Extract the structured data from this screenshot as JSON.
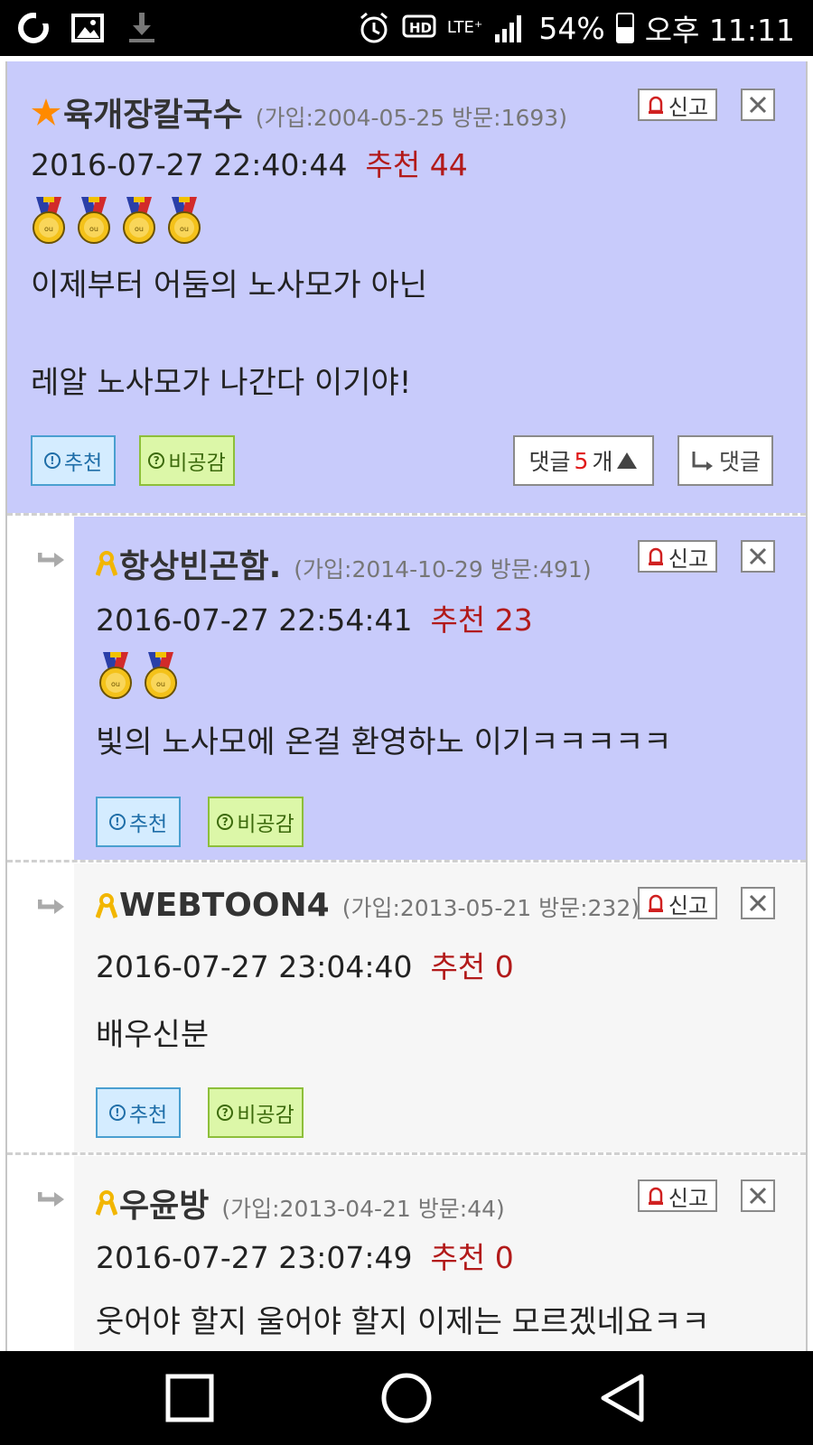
{
  "status_bar": {
    "battery": "54%",
    "time": "오후 11:11",
    "network": "LTE⁺",
    "battery_level": 0.54
  },
  "comments": [
    {
      "nickname": "육개장칼국수",
      "meta": "(가입:2004-05-25 방문:1693)",
      "datetime": "2016-07-27 22:40:44",
      "recommend": "추천 44",
      "medal_count": 4,
      "text_line1": "이제부터 어둠의 노사모가 아닌",
      "text_line2": "레알 노사모가 나간다 이기야!",
      "report_label": "신고",
      "recommend_btn": "추천",
      "disagree_btn": "비공감",
      "reply_count_prefix": "댓글 ",
      "reply_count_num": "5",
      "reply_count_suffix": "개",
      "reply_btn": "댓글"
    },
    {
      "nickname": "항상빈곤함.",
      "meta": "(가입:2014-10-29 방문:491)",
      "datetime": "2016-07-27 22:54:41",
      "recommend": "추천 23",
      "medal_count": 2,
      "text": "빛의 노사모에 온걸 환영하노 이기ㅋㅋㅋㅋㅋ",
      "report_label": "신고",
      "recommend_btn": "추천",
      "disagree_btn": "비공감"
    },
    {
      "nickname": "WEBTOON4",
      "meta": "(가입:2013-05-21 방문:232)",
      "datetime": "2016-07-27 23:04:40",
      "recommend": "추천 0",
      "text": "배우신분",
      "report_label": "신고",
      "recommend_btn": "추천",
      "disagree_btn": "비공감"
    },
    {
      "nickname": "우윤방",
      "meta": "(가입:2013-04-21 방문:44)",
      "datetime": "2016-07-27 23:07:49",
      "recommend": "추천 0",
      "text": "웃어야 할지 울어야 할지 이제는 모르겠네요ㅋㅋ",
      "report_label": "신고"
    }
  ],
  "colors": {
    "best_bg": "#c8cbfb",
    "normal_bg": "#f6f6f6",
    "recommend_red": "#b21a1a"
  }
}
